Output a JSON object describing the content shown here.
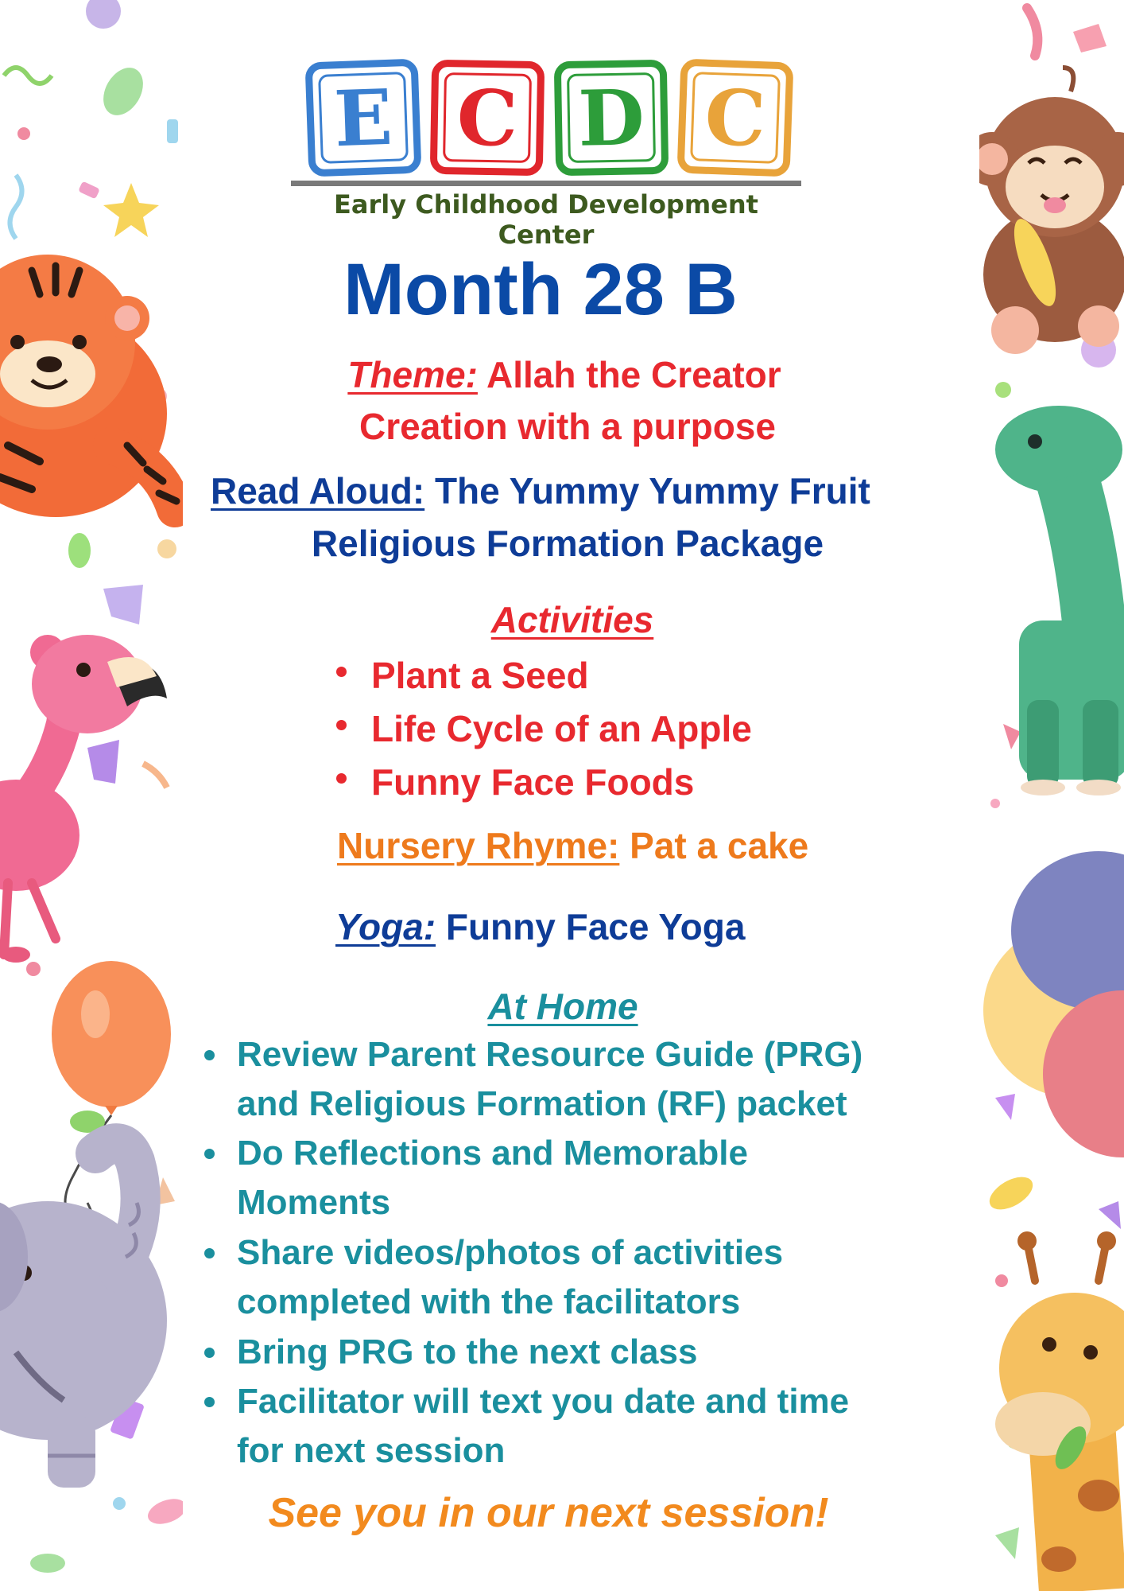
{
  "logo": {
    "letters": [
      "E",
      "C",
      "D",
      "C"
    ],
    "colors": [
      "#3a7fd0",
      "#e0262c",
      "#2d9d3a",
      "#e8a33a"
    ],
    "subtitle": "Early Childhood Development Center"
  },
  "title": "Month 28 B",
  "theme": {
    "label": "Theme:",
    "line1": "Allah the Creator",
    "line2": "Creation with a purpose"
  },
  "read_aloud": {
    "label": "Read Aloud:",
    "line1": "The Yummy Yummy Fruit",
    "line2": "Religious Formation Package"
  },
  "activities": {
    "heading": "Activities",
    "items": [
      "Plant a Seed",
      "Life Cycle of an Apple",
      "Funny Face Foods"
    ]
  },
  "nursery_rhyme": {
    "label": "Nursery Rhyme:",
    "value": "Pat a cake"
  },
  "yoga": {
    "label": "Yoga:",
    "value": "Funny Face Yoga"
  },
  "at_home": {
    "heading": "At Home",
    "items": [
      {
        "line1": "Review Parent Resource Guide (PRG)",
        "line2": "and Religious Formation (RF) packet"
      },
      {
        "line1": "Do Reflections and Memorable",
        "line2": "Moments"
      },
      {
        "line1": "Share videos/photos of activities",
        "line2": "completed with the facilitators"
      },
      {
        "line1": "Bring PRG to the next class",
        "line2": ""
      },
      {
        "line1": "Facilitator will text you date and time",
        "line2": "for next session"
      }
    ]
  },
  "closing": "See you in our next session!",
  "colors": {
    "title_blue": "#0b4aa6",
    "theme_red": "#e8292f",
    "read_blue": "#0e3c97",
    "rhyme_orange": "#ee7a1c",
    "home_teal": "#1a8f9e",
    "closing_orange": "#f28a1e"
  },
  "decorations": {
    "left": [
      "tiger-illustration",
      "flamingo-illustration",
      "balloon-illustration",
      "elephant-illustration",
      "confetti"
    ],
    "right": [
      "monkey-illustration",
      "dinosaur-illustration",
      "balloons-illustration",
      "giraffe-illustration",
      "confetti"
    ]
  }
}
